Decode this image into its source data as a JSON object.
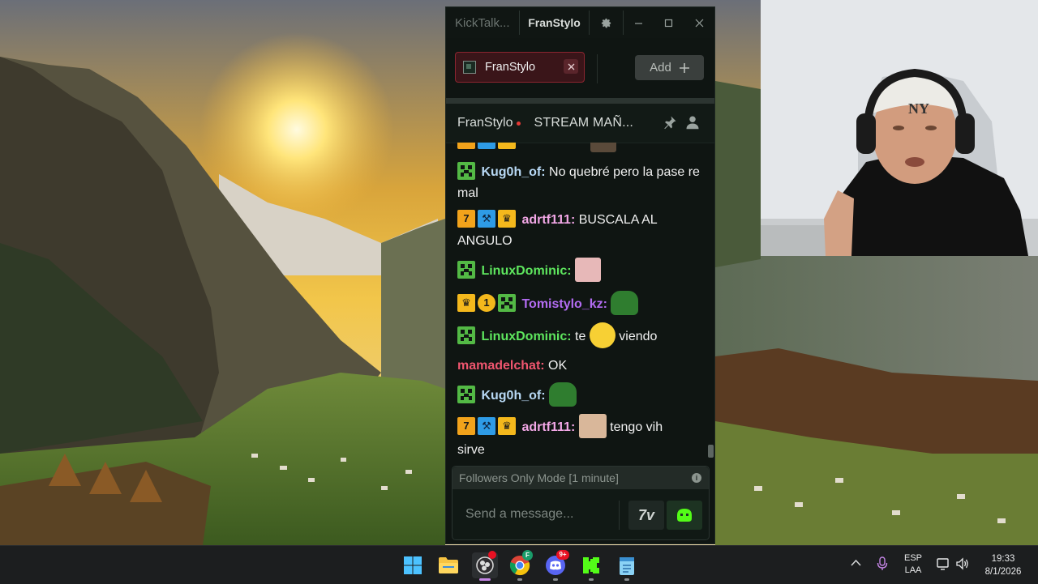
{
  "window": {
    "app_title": "KickTalk...",
    "active_tab": "FranStylo"
  },
  "channel_tabs": {
    "channel": "FranStylo",
    "add_label": "Add"
  },
  "chat_header": {
    "channel": "FranStylo",
    "stream_title": "STREAM MAÑ..."
  },
  "messages": [
    {
      "user": "Kug0h_of:",
      "user_color": "#b8d9f5",
      "text": "No quebré pero la pase re mal"
    },
    {
      "user": "adrtf111:",
      "user_color": "#f2a7e6",
      "text": "BUSCALA AL ANGULO"
    },
    {
      "user": "LinuxDominic:",
      "user_color": "#5ee65e",
      "text": ""
    },
    {
      "user": "Tomistylo_kz:",
      "user_color": "#b36cf2",
      "text": ""
    },
    {
      "user": "LinuxDominic:",
      "user_color": "#5ee65e",
      "text_before": "te",
      "text_after": "viendo"
    },
    {
      "user": "mamadelchat:",
      "user_color": "#f0566f",
      "text": "OK"
    },
    {
      "user": "Kug0h_of:",
      "user_color": "#b8d9f5",
      "text": ""
    },
    {
      "user": "adrtf111:",
      "user_color": "#f2a7e6",
      "text_after": "tengo vih",
      "text_wrap": "sirve"
    }
  ],
  "input": {
    "followers_mode": "Followers Only Mode [1 minute]",
    "placeholder": "Send a message..."
  },
  "taskbar": {
    "apps": [
      "start-icon",
      "file-explorer-icon",
      "obs-icon",
      "chrome-icon",
      "discord-icon",
      "kick-icon",
      "notepad-icon"
    ],
    "discord_badge": "9+",
    "chrome_profile": "F",
    "lang_line1": "ESP",
    "lang_line2": "LAA",
    "time": "19:33",
    "date": "8/1/2026"
  }
}
